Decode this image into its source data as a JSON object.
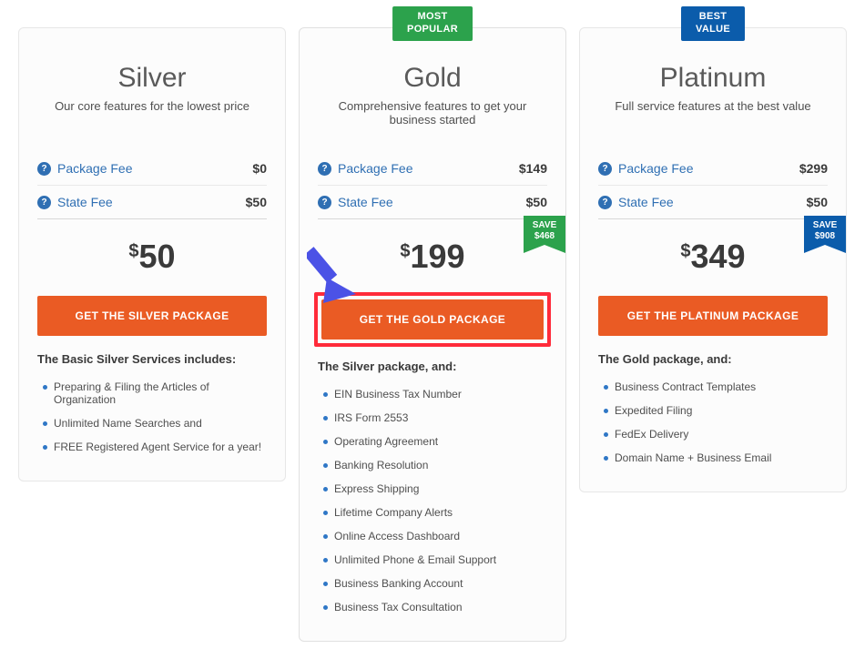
{
  "plans": [
    {
      "name": "Silver",
      "tagline": "Our core features for the lowest price",
      "badge": null,
      "package_fee_label": "Package Fee",
      "package_fee_value": "$0",
      "state_fee_label": "State Fee",
      "state_fee_value": "$50",
      "total": "50",
      "save": null,
      "cta": "GET THE SILVER PACKAGE",
      "cta_highlight": false,
      "features_heading": "The Basic Silver Services includes:",
      "features": [
        "Preparing & Filing the Articles of Organization",
        "Unlimited Name Searches and",
        "FREE Registered Agent Service for a year!"
      ]
    },
    {
      "name": "Gold",
      "tagline": "Comprehensive features to get your business started",
      "badge": {
        "text": "MOST\nPOPULAR",
        "color": "green"
      },
      "package_fee_label": "Package Fee",
      "package_fee_value": "$149",
      "state_fee_label": "State Fee",
      "state_fee_value": "$50",
      "total": "199",
      "save": {
        "label": "SAVE",
        "amount": "$468",
        "color": "green"
      },
      "cta": "GET THE GOLD PACKAGE",
      "cta_highlight": true,
      "arrow": true,
      "features_heading": "The Silver package, and:",
      "features": [
        "EIN Business Tax Number",
        "IRS Form 2553",
        "Operating Agreement",
        "Banking Resolution",
        "Express Shipping",
        "Lifetime Company Alerts",
        "Online Access Dashboard",
        "Unlimited Phone & Email Support",
        "Business Banking Account",
        "Business Tax Consultation"
      ]
    },
    {
      "name": "Platinum",
      "tagline": "Full service features at the best value",
      "badge": {
        "text": "BEST\nVALUE",
        "color": "blue"
      },
      "package_fee_label": "Package Fee",
      "package_fee_value": "$299",
      "state_fee_label": "State Fee",
      "state_fee_value": "$50",
      "total": "349",
      "save": {
        "label": "SAVE",
        "amount": "$908",
        "color": "blue"
      },
      "cta": "GET THE PLATINUM PACKAGE",
      "cta_highlight": false,
      "features_heading": "The Gold package, and:",
      "features": [
        "Business Contract Templates",
        "Expedited Filing",
        "FedEx Delivery",
        "Domain Name + Business Email"
      ]
    }
  ]
}
